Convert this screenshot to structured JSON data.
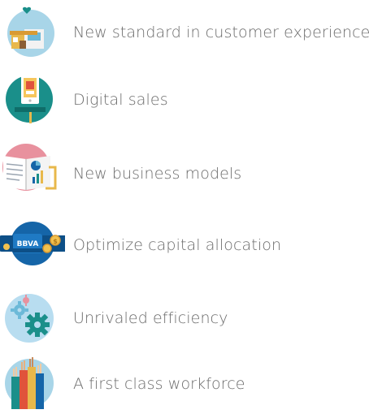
{
  "items": [
    {
      "label": "New standard in customer experience",
      "icon": "storefront-icon",
      "color": "#a8d5e8"
    },
    {
      "label": "Digital sales",
      "icon": "smartphone-shopping-icon",
      "color": "#1a8f8a"
    },
    {
      "label": "New business models",
      "icon": "analytics-book-icon",
      "color": "#e8919e"
    },
    {
      "label": "Optimize capital allocation",
      "icon": "bbva-card-coins-icon",
      "color": "#1565a8",
      "icon_text": "BBVA"
    },
    {
      "label": "Unrivaled efficiency",
      "icon": "gears-icon",
      "color": "#b8ddf0"
    },
    {
      "label": "A first class workforce",
      "icon": "raised-hands-icon",
      "color": "#a8d5e8"
    }
  ]
}
